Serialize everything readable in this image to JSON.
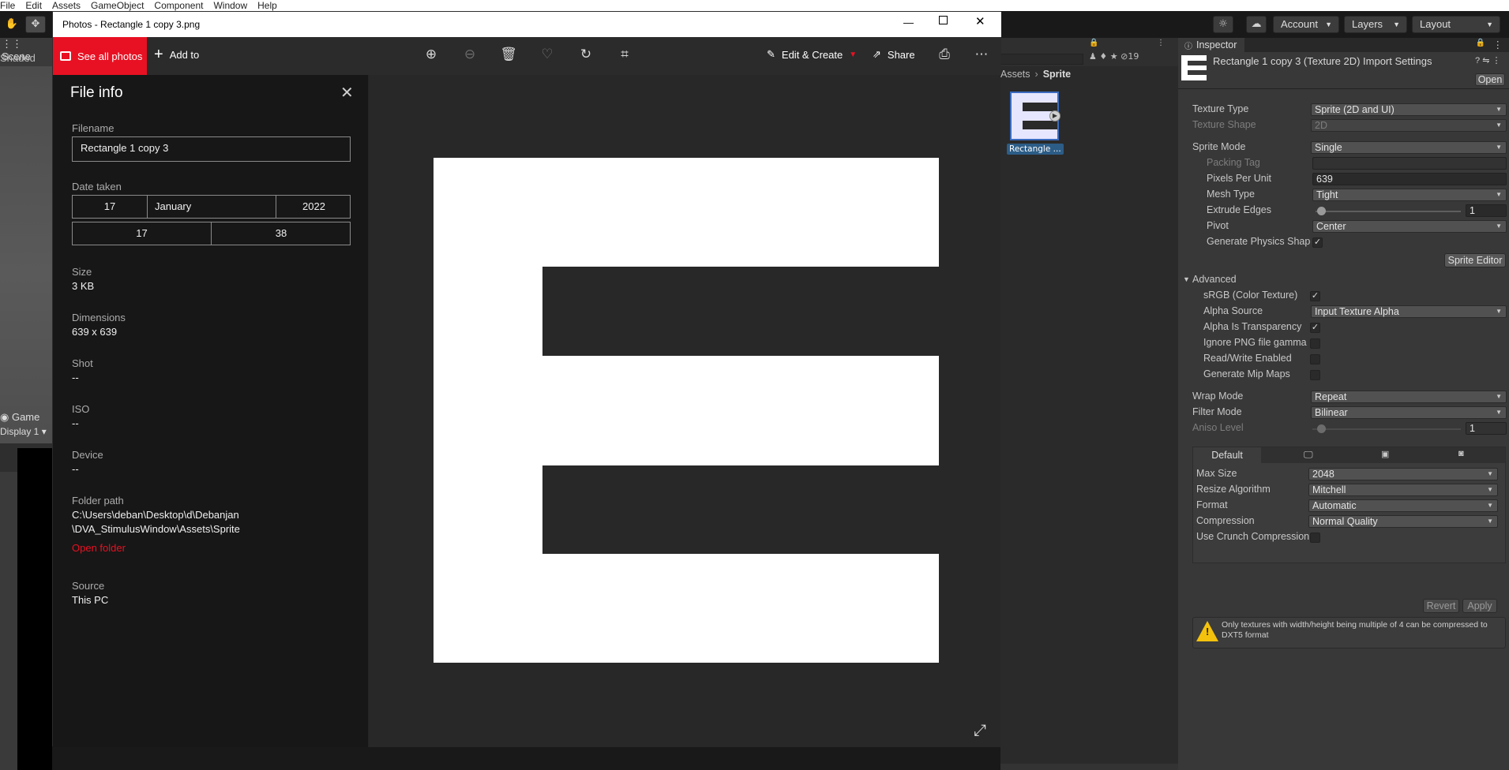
{
  "menubar": {
    "items": [
      "File",
      "Edit",
      "Assets",
      "GameObject",
      "Component",
      "Window",
      "Help"
    ]
  },
  "unity": {
    "account": "Account",
    "layers": "Layers",
    "layout": "Layout",
    "scene_tab": "Scene",
    "shading": "Shaded",
    "game_tab": "Game",
    "display": "Display 1",
    "breadcrumb": [
      "Assets",
      "Sprite"
    ],
    "asset_label": "Rectangle ...",
    "hidden_count": "19"
  },
  "photos": {
    "title": "Photos - Rectangle 1 copy 3.png",
    "see_all": "See all photos",
    "add_to": "Add to",
    "edit_create": "Edit & Create",
    "share": "Share"
  },
  "fileinfo": {
    "heading": "File info",
    "filename_label": "Filename",
    "filename": "Rectangle 1 copy 3",
    "date_label": "Date taken",
    "day": "17",
    "month": "January",
    "year": "2022",
    "hour": "17",
    "minute": "38",
    "size_label": "Size",
    "size": "3 KB",
    "dimensions_label": "Dimensions",
    "dimensions": "639 x 639",
    "shot_label": "Shot",
    "shot": "--",
    "iso_label": "ISO",
    "iso": "--",
    "device_label": "Device",
    "device": "--",
    "folder_label": "Folder path",
    "folder_line1": "C:\\Users\\deban\\Desktop\\d\\Debanjan",
    "folder_line2": "\\DVA_StimulusWindow\\Assets\\Sprite",
    "open_folder": "Open folder",
    "source_label": "Source",
    "source": "This PC"
  },
  "inspector": {
    "tab": "Inspector",
    "title": "Rectangle 1 copy 3 (Texture 2D) Import Settings",
    "open": "Open",
    "texture_type_label": "Texture Type",
    "texture_type": "Sprite (2D and UI)",
    "texture_shape_label": "Texture Shape",
    "texture_shape": "2D",
    "sprite_mode_label": "Sprite Mode",
    "sprite_mode": "Single",
    "packing_tag_label": "Packing Tag",
    "ppu_label": "Pixels Per Unit",
    "ppu": "639",
    "mesh_type_label": "Mesh Type",
    "mesh_type": "Tight",
    "extrude_label": "Extrude Edges",
    "extrude": "1",
    "pivot_label": "Pivot",
    "pivot": "Center",
    "physics_label": "Generate Physics Shape",
    "sprite_editor": "Sprite Editor",
    "advanced": "Advanced",
    "srgb_label": "sRGB (Color Texture)",
    "alpha_source_label": "Alpha Source",
    "alpha_source": "Input Texture Alpha",
    "alpha_transp_label": "Alpha Is Transparency",
    "ignore_png_label": "Ignore PNG file gamma",
    "readwrite_label": "Read/Write Enabled",
    "mipmaps_label": "Generate Mip Maps",
    "wrap_label": "Wrap Mode",
    "wrap": "Repeat",
    "filter_label": "Filter Mode",
    "filter": "Bilinear",
    "aniso_label": "Aniso Level",
    "aniso": "1",
    "platform_default": "Default",
    "max_size_label": "Max Size",
    "max_size": "2048",
    "resize_label": "Resize Algorithm",
    "resize": "Mitchell",
    "format_label": "Format",
    "format": "Automatic",
    "compression_label": "Compression",
    "compression": "Normal Quality",
    "crunch_label": "Use Crunch Compression",
    "revert": "Revert",
    "apply": "Apply",
    "warning": "Only textures with width/height being multiple of 4 can be compressed to DXT5 format"
  },
  "colors": {
    "accent_red": "#e81123",
    "warning_yellow": "#f4c20d"
  }
}
